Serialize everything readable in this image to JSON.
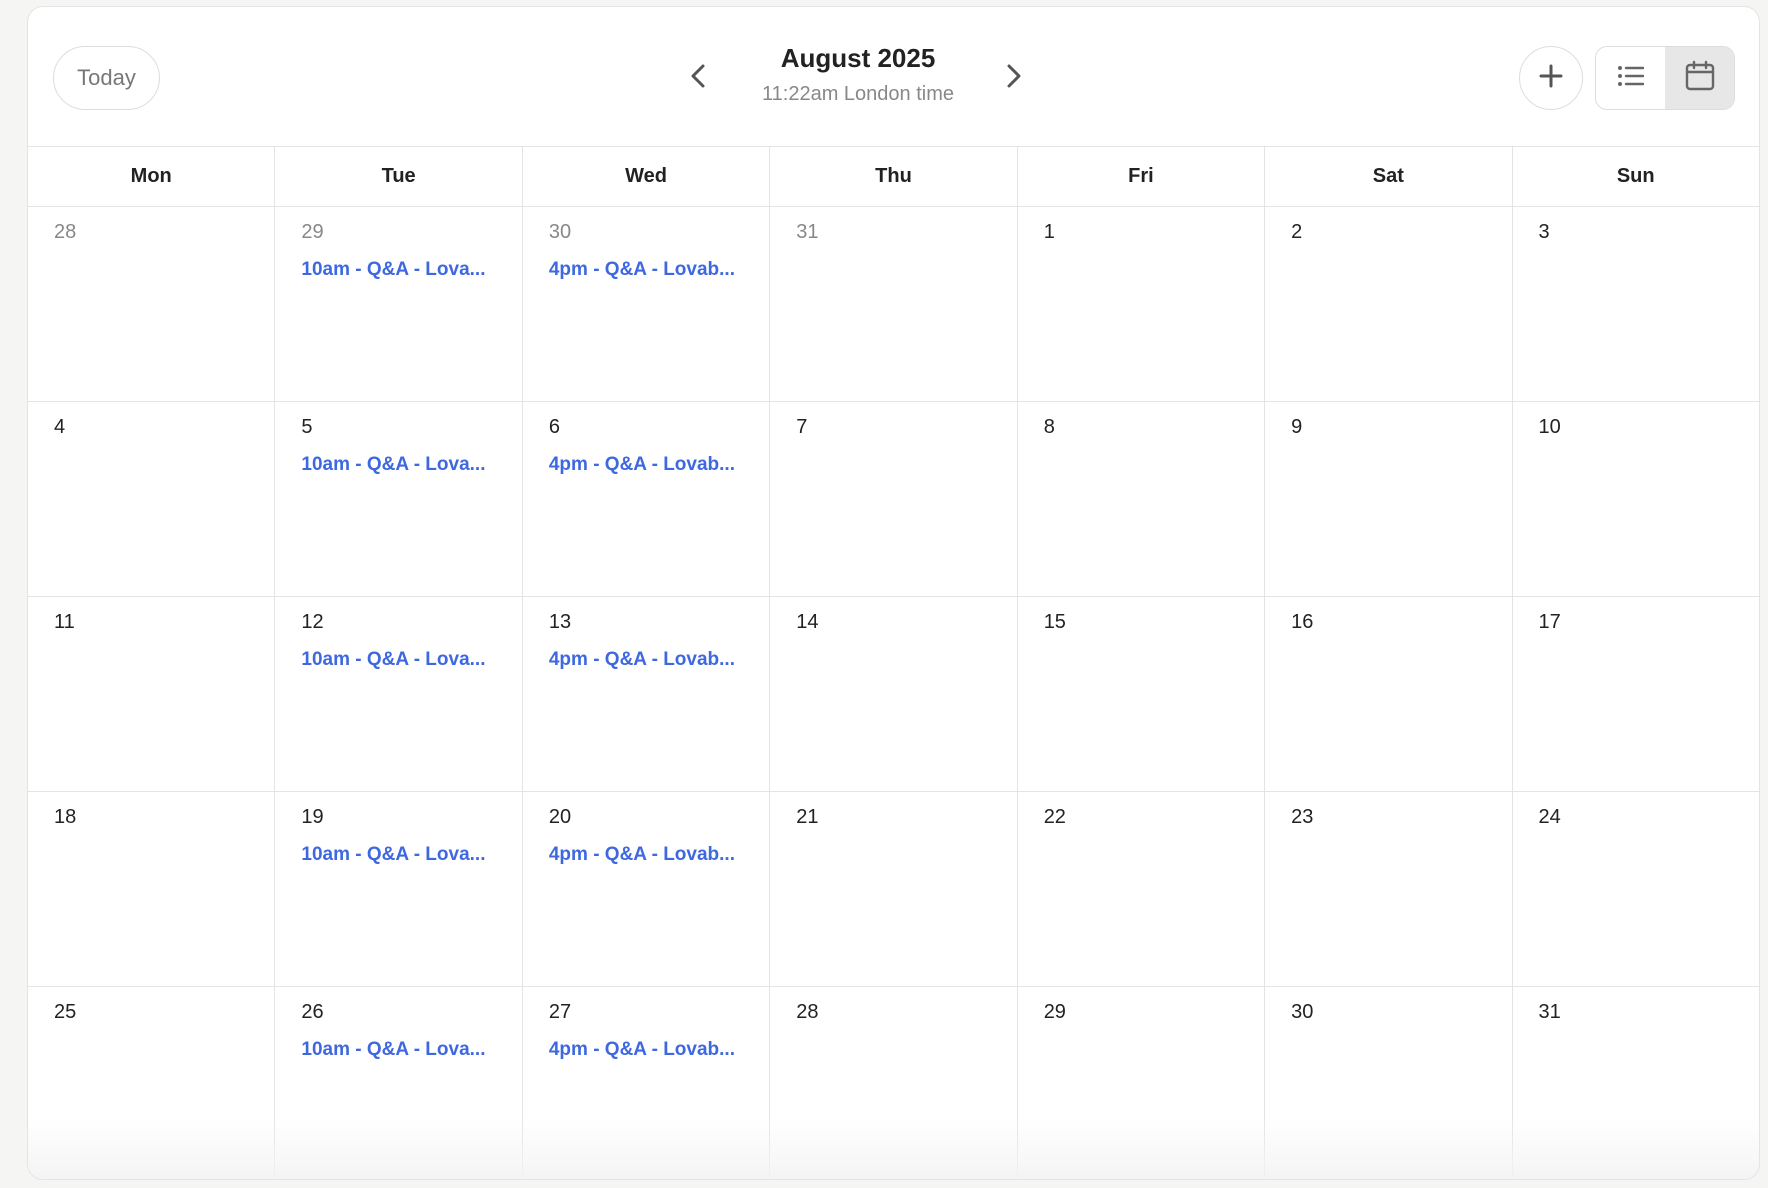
{
  "header": {
    "today_label": "Today",
    "month_title": "August 2025",
    "local_time": "11:22am London time",
    "prev_icon": "chevron-left-icon",
    "next_icon": "chevron-right-icon",
    "add_icon": "plus-icon",
    "views": [
      {
        "name": "list",
        "icon": "list-icon",
        "active": false
      },
      {
        "name": "calendar",
        "icon": "calendar-icon",
        "active": true
      }
    ]
  },
  "weekdays": [
    "Mon",
    "Tue",
    "Wed",
    "Thu",
    "Fri",
    "Sat",
    "Sun"
  ],
  "weeks": [
    [
      {
        "day": "28",
        "other_month": true,
        "events": []
      },
      {
        "day": "29",
        "other_month": true,
        "events": [
          "10am - Q&A - Lova..."
        ]
      },
      {
        "day": "30",
        "other_month": true,
        "events": [
          "4pm - Q&A - Lovab..."
        ]
      },
      {
        "day": "31",
        "other_month": true,
        "events": []
      },
      {
        "day": "1",
        "other_month": false,
        "events": []
      },
      {
        "day": "2",
        "other_month": false,
        "events": []
      },
      {
        "day": "3",
        "other_month": false,
        "events": []
      }
    ],
    [
      {
        "day": "4",
        "other_month": false,
        "events": []
      },
      {
        "day": "5",
        "other_month": false,
        "events": [
          "10am - Q&A - Lova..."
        ]
      },
      {
        "day": "6",
        "other_month": false,
        "events": [
          "4pm - Q&A - Lovab..."
        ]
      },
      {
        "day": "7",
        "other_month": false,
        "events": []
      },
      {
        "day": "8",
        "other_month": false,
        "events": []
      },
      {
        "day": "9",
        "other_month": false,
        "events": []
      },
      {
        "day": "10",
        "other_month": false,
        "events": []
      }
    ],
    [
      {
        "day": "11",
        "other_month": false,
        "events": []
      },
      {
        "day": "12",
        "other_month": false,
        "events": [
          "10am - Q&A - Lova..."
        ]
      },
      {
        "day": "13",
        "other_month": false,
        "events": [
          "4pm - Q&A - Lovab..."
        ]
      },
      {
        "day": "14",
        "other_month": false,
        "events": []
      },
      {
        "day": "15",
        "other_month": false,
        "events": []
      },
      {
        "day": "16",
        "other_month": false,
        "events": []
      },
      {
        "day": "17",
        "other_month": false,
        "events": []
      }
    ],
    [
      {
        "day": "18",
        "other_month": false,
        "events": []
      },
      {
        "day": "19",
        "other_month": false,
        "events": [
          "10am - Q&A - Lova..."
        ]
      },
      {
        "day": "20",
        "other_month": false,
        "events": [
          "4pm - Q&A - Lovab..."
        ]
      },
      {
        "day": "21",
        "other_month": false,
        "events": []
      },
      {
        "day": "22",
        "other_month": false,
        "events": []
      },
      {
        "day": "23",
        "other_month": false,
        "events": []
      },
      {
        "day": "24",
        "other_month": false,
        "events": []
      }
    ],
    [
      {
        "day": "25",
        "other_month": false,
        "events": []
      },
      {
        "day": "26",
        "other_month": false,
        "events": [
          "10am - Q&A - Lova..."
        ]
      },
      {
        "day": "27",
        "other_month": false,
        "events": [
          "4pm - Q&A - Lovab..."
        ]
      },
      {
        "day": "28",
        "other_month": false,
        "events": []
      },
      {
        "day": "29",
        "other_month": false,
        "events": []
      },
      {
        "day": "30",
        "other_month": false,
        "events": []
      },
      {
        "day": "31",
        "other_month": false,
        "events": []
      }
    ]
  ],
  "colors": {
    "event": "#3e68e0",
    "muted_day": "#888888",
    "active_view_bg": "#e7e7e7",
    "border": "#e4e4e4"
  }
}
